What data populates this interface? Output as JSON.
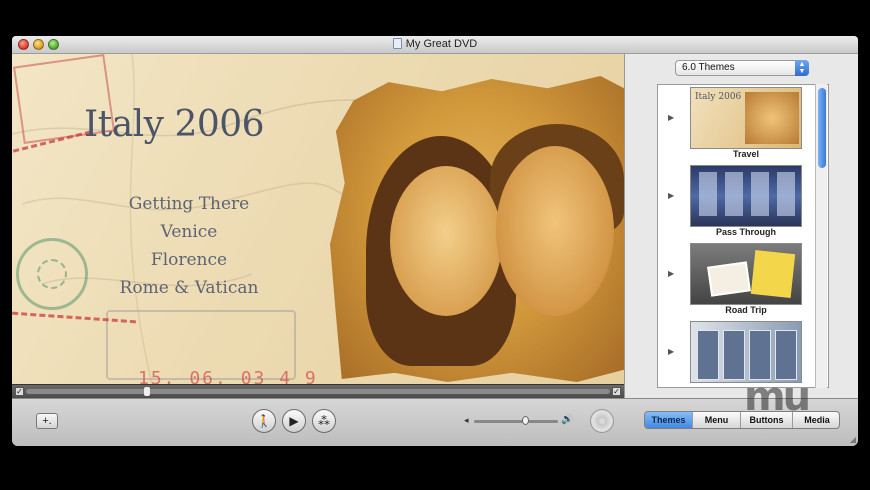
{
  "window": {
    "title": "My Great DVD"
  },
  "preview": {
    "menu_title": "Italy 2006",
    "menu_items": [
      "Getting There",
      "Venice",
      "Florence",
      "Rome & Vatican"
    ],
    "postmark_date": "15. 06. 03 4 9"
  },
  "sidebar": {
    "theme_set": "6.0 Themes",
    "themes": [
      {
        "label": "Travel",
        "thumb_title": "Italy 2006"
      },
      {
        "label": "Pass Through"
      },
      {
        "label": "Road Trip"
      },
      {
        "label": ""
      }
    ]
  },
  "toolbar": {
    "add_label": "+.",
    "tabs": [
      "Themes",
      "Menu",
      "Buttons",
      "Media"
    ],
    "active_tab": "Themes"
  },
  "colors": {
    "accent": "#3b81de",
    "title_text": "#4b5567"
  },
  "watermark": "mu"
}
